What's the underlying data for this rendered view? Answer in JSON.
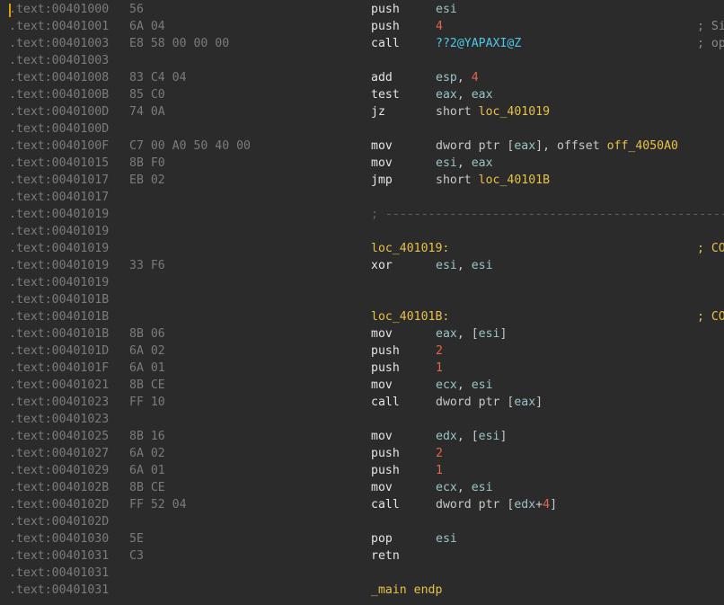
{
  "rows": [
    {
      "addr": ".text:00401000",
      "bytes": "56",
      "mnemonic": "push",
      "operands": [
        {
          "t": "esi",
          "c": "reg"
        }
      ]
    },
    {
      "addr": ".text:00401001",
      "bytes": "6A 04",
      "mnemonic": "push",
      "operands": [
        {
          "t": "4",
          "c": "num"
        }
      ],
      "comment": "; Si"
    },
    {
      "addr": ".text:00401003",
      "bytes": "E8 58 00 00 00",
      "mnemonic": "call",
      "operands": [
        {
          "t": "??2@YAPAXI@Z",
          "c": "fn"
        }
      ],
      "comment": "; op"
    },
    {
      "addr": ".text:00401003"
    },
    {
      "addr": ".text:00401008",
      "bytes": "83 C4 04",
      "mnemonic": "add",
      "operands": [
        {
          "t": "esp",
          "c": "reg"
        },
        {
          "t": ", ",
          "c": "kw"
        },
        {
          "t": "4",
          "c": "num"
        }
      ]
    },
    {
      "addr": ".text:0040100B",
      "bytes": "85 C0",
      "mnemonic": "test",
      "operands": [
        {
          "t": "eax",
          "c": "reg"
        },
        {
          "t": ", ",
          "c": "kw"
        },
        {
          "t": "eax",
          "c": "reg"
        }
      ]
    },
    {
      "addr": ".text:0040100D",
      "bytes": "74 0A",
      "mnemonic": "jz",
      "operands": [
        {
          "t": "short ",
          "c": "kw"
        },
        {
          "t": "loc_401019",
          "c": "ref"
        }
      ]
    },
    {
      "addr": ".text:0040100D"
    },
    {
      "addr": ".text:0040100F",
      "bytes": "C7 00 A0 50 40 00",
      "mnemonic": "mov",
      "operands": [
        {
          "t": "dword ptr [",
          "c": "kw"
        },
        {
          "t": "eax",
          "c": "reg"
        },
        {
          "t": "], offset ",
          "c": "kw"
        },
        {
          "t": "off_4050A0",
          "c": "ref"
        }
      ]
    },
    {
      "addr": ".text:00401015",
      "bytes": "8B F0",
      "mnemonic": "mov",
      "operands": [
        {
          "t": "esi",
          "c": "reg"
        },
        {
          "t": ", ",
          "c": "kw"
        },
        {
          "t": "eax",
          "c": "reg"
        }
      ]
    },
    {
      "addr": ".text:00401017",
      "bytes": "EB 02",
      "mnemonic": "jmp",
      "operands": [
        {
          "t": "short ",
          "c": "kw"
        },
        {
          "t": "loc_40101B",
          "c": "ref"
        }
      ]
    },
    {
      "addr": ".text:00401017"
    },
    {
      "addr": ".text:00401019",
      "separator": "; ----------------------------------------------------------------"
    },
    {
      "addr": ".text:00401019"
    },
    {
      "addr": ".text:00401019",
      "label": "loc_401019:",
      "comment": "; CO"
    },
    {
      "addr": ".text:00401019",
      "bytes": "33 F6",
      "mnemonic": "xor",
      "operands": [
        {
          "t": "esi",
          "c": "reg"
        },
        {
          "t": ", ",
          "c": "kw"
        },
        {
          "t": "esi",
          "c": "reg"
        }
      ]
    },
    {
      "addr": ".text:00401019"
    },
    {
      "addr": ".text:0040101B"
    },
    {
      "addr": ".text:0040101B",
      "label": "loc_40101B:",
      "comment": "; CO"
    },
    {
      "addr": ".text:0040101B",
      "bytes": "8B 06",
      "mnemonic": "mov",
      "operands": [
        {
          "t": "eax",
          "c": "reg"
        },
        {
          "t": ", [",
          "c": "kw"
        },
        {
          "t": "esi",
          "c": "reg"
        },
        {
          "t": "]",
          "c": "kw"
        }
      ]
    },
    {
      "addr": ".text:0040101D",
      "bytes": "6A 02",
      "mnemonic": "push",
      "operands": [
        {
          "t": "2",
          "c": "num"
        }
      ]
    },
    {
      "addr": ".text:0040101F",
      "bytes": "6A 01",
      "mnemonic": "push",
      "operands": [
        {
          "t": "1",
          "c": "num"
        }
      ]
    },
    {
      "addr": ".text:00401021",
      "bytes": "8B CE",
      "mnemonic": "mov",
      "operands": [
        {
          "t": "ecx",
          "c": "reg"
        },
        {
          "t": ", ",
          "c": "kw"
        },
        {
          "t": "esi",
          "c": "reg"
        }
      ]
    },
    {
      "addr": ".text:00401023",
      "bytes": "FF 10",
      "mnemonic": "call",
      "operands": [
        {
          "t": "dword ptr [",
          "c": "kw"
        },
        {
          "t": "eax",
          "c": "reg"
        },
        {
          "t": "]",
          "c": "kw"
        }
      ]
    },
    {
      "addr": ".text:00401023"
    },
    {
      "addr": ".text:00401025",
      "bytes": "8B 16",
      "mnemonic": "mov",
      "operands": [
        {
          "t": "edx",
          "c": "reg"
        },
        {
          "t": ", [",
          "c": "kw"
        },
        {
          "t": "esi",
          "c": "reg"
        },
        {
          "t": "]",
          "c": "kw"
        }
      ]
    },
    {
      "addr": ".text:00401027",
      "bytes": "6A 02",
      "mnemonic": "push",
      "operands": [
        {
          "t": "2",
          "c": "num"
        }
      ]
    },
    {
      "addr": ".text:00401029",
      "bytes": "6A 01",
      "mnemonic": "push",
      "operands": [
        {
          "t": "1",
          "c": "num"
        }
      ]
    },
    {
      "addr": ".text:0040102B",
      "bytes": "8B CE",
      "mnemonic": "mov",
      "operands": [
        {
          "t": "ecx",
          "c": "reg"
        },
        {
          "t": ", ",
          "c": "kw"
        },
        {
          "t": "esi",
          "c": "reg"
        }
      ]
    },
    {
      "addr": ".text:0040102D",
      "bytes": "FF 52 04",
      "mnemonic": "call",
      "operands": [
        {
          "t": "dword ptr [",
          "c": "kw"
        },
        {
          "t": "edx",
          "c": "reg"
        },
        {
          "t": "+",
          "c": "kw"
        },
        {
          "t": "4",
          "c": "num"
        },
        {
          "t": "]",
          "c": "kw"
        }
      ]
    },
    {
      "addr": ".text:0040102D"
    },
    {
      "addr": ".text:00401030",
      "bytes": "5E",
      "mnemonic": "pop",
      "operands": [
        {
          "t": "esi",
          "c": "reg"
        }
      ]
    },
    {
      "addr": ".text:00401031",
      "bytes": "C3",
      "mnemonic": "retn",
      "operands": []
    },
    {
      "addr": ".text:00401031"
    },
    {
      "addr": ".text:00401031",
      "label": "_main endp"
    }
  ]
}
